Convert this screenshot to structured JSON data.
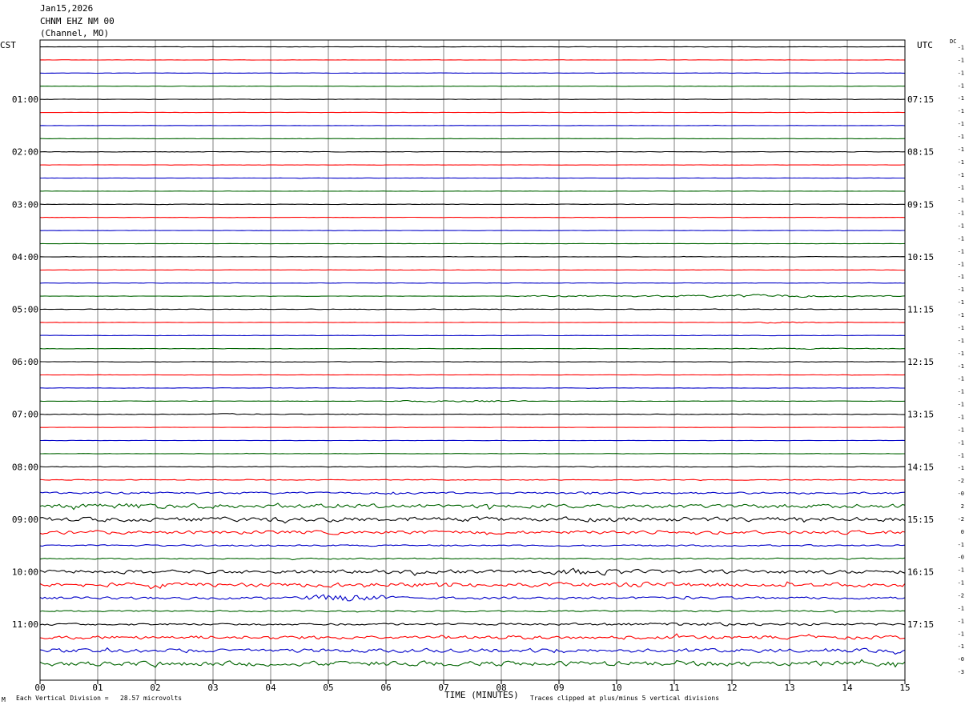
{
  "header": {
    "date": "Jan15,2026",
    "station": "CHNM EHZ NM 00",
    "network": "(Channel, MO)"
  },
  "left_timezone": "CST",
  "right_timezone": "UTC",
  "dc_label": "DC",
  "footer": {
    "scale_note": "Each Vertical Division =   28.57 microvolts",
    "clip_note": "Traces clipped at plus/minus 5 vertical divisions",
    "marker": "M"
  },
  "chart_data": {
    "type": "line",
    "title": "",
    "xlabel": "TIME (MINUTES)",
    "ylabel": "",
    "xlim": [
      0,
      15
    ],
    "x_ticks": [
      "00",
      "01",
      "02",
      "03",
      "04",
      "05",
      "06",
      "07",
      "08",
      "09",
      "10",
      "11",
      "12",
      "13",
      "14",
      "15"
    ],
    "grid": true,
    "trace_colors": [
      "#000000",
      "#ff0000",
      "#0000c8",
      "#006400"
    ],
    "traces_per_hour": 4,
    "trace_minutes": 15,
    "num_traces": 48,
    "left_hour_labels": [
      {
        "trace": 4,
        "label": "01:00"
      },
      {
        "trace": 8,
        "label": "02:00"
      },
      {
        "trace": 12,
        "label": "03:00"
      },
      {
        "trace": 16,
        "label": "04:00"
      },
      {
        "trace": 20,
        "label": "05:00"
      },
      {
        "trace": 24,
        "label": "06:00"
      },
      {
        "trace": 28,
        "label": "07:00"
      },
      {
        "trace": 32,
        "label": "08:00"
      },
      {
        "trace": 36,
        "label": "09:00"
      },
      {
        "trace": 40,
        "label": "10:00"
      },
      {
        "trace": 44,
        "label": "11:00"
      }
    ],
    "right_hour_labels": [
      {
        "trace": 4,
        "label": "07:15"
      },
      {
        "trace": 8,
        "label": "08:15"
      },
      {
        "trace": 12,
        "label": "09:15"
      },
      {
        "trace": 16,
        "label": "10:15"
      },
      {
        "trace": 20,
        "label": "11:15"
      },
      {
        "trace": 24,
        "label": "12:15"
      },
      {
        "trace": 28,
        "label": "13:15"
      },
      {
        "trace": 32,
        "label": "14:15"
      },
      {
        "trace": 36,
        "label": "15:15"
      },
      {
        "trace": 40,
        "label": "16:15"
      },
      {
        "trace": 44,
        "label": "17:15"
      }
    ],
    "dc_offsets": [
      "-1",
      "-1",
      "-1",
      "-1",
      "-1",
      "-1",
      "-1",
      "-1",
      "-1",
      "-1",
      "-1",
      "-1",
      "-1",
      "-1",
      "-1",
      "-1",
      "-1",
      "-1",
      "-1",
      "-1",
      "-1",
      "-1",
      "-1",
      "-1",
      "-1",
      "-1",
      "-1",
      "-1",
      "-1",
      "-1",
      "-1",
      "-1",
      "-1",
      "-1",
      "-2",
      "-0",
      "2",
      "-2",
      "0",
      "-1",
      "-0",
      "-1",
      "-1",
      "-2",
      "-1",
      "-1",
      "-1",
      "-1",
      "-0",
      "-3"
    ],
    "traces": [
      {
        "i": 0,
        "base": 0.3
      },
      {
        "i": 1,
        "base": 0.25
      },
      {
        "i": 2,
        "base": 0.25
      },
      {
        "i": 3,
        "base": 0.25
      },
      {
        "i": 4,
        "base": 0.3
      },
      {
        "i": 5,
        "base": 0.25
      },
      {
        "i": 6,
        "base": 0.25
      },
      {
        "i": 7,
        "base": 0.25
      },
      {
        "i": 8,
        "base": 0.3
      },
      {
        "i": 9,
        "base": 0.25
      },
      {
        "i": 10,
        "base": 0.25
      },
      {
        "i": 11,
        "base": 0.25
      },
      {
        "i": 12,
        "base": 0.3
      },
      {
        "i": 13,
        "base": 0.25
      },
      {
        "i": 14,
        "base": 0.25
      },
      {
        "i": 15,
        "base": 0.25
      },
      {
        "i": 16,
        "base": 0.3
      },
      {
        "i": 17,
        "base": 0.25
      },
      {
        "i": 18,
        "base": 0.3
      },
      {
        "i": 19,
        "base": 0.3,
        "bursts": [
          [
            8.0,
            15.0,
            1.6
          ],
          [
            11.5,
            13.5,
            3.0
          ]
        ]
      },
      {
        "i": 20,
        "base": 0.5
      },
      {
        "i": 21,
        "base": 0.25,
        "bursts": [
          [
            12.0,
            14.0,
            1.2
          ]
        ]
      },
      {
        "i": 22,
        "base": 0.3
      },
      {
        "i": 23,
        "base": 0.3,
        "bursts": [
          [
            11.8,
            15.0,
            1.0
          ]
        ]
      },
      {
        "i": 24,
        "base": 0.4
      },
      {
        "i": 25,
        "base": 0.25
      },
      {
        "i": 26,
        "base": 0.3
      },
      {
        "i": 27,
        "base": 0.3,
        "bursts": [
          [
            6.0,
            8.5,
            1.6
          ]
        ]
      },
      {
        "i": 28,
        "base": 0.5,
        "bursts": [
          [
            3.0,
            3.5,
            1.8
          ],
          [
            5.2,
            5.6,
            1.6
          ]
        ]
      },
      {
        "i": 29,
        "base": 0.25
      },
      {
        "i": 30,
        "base": 0.3
      },
      {
        "i": 31,
        "base": 0.3
      },
      {
        "i": 32,
        "base": 0.5
      },
      {
        "i": 33,
        "base": 0.6
      },
      {
        "i": 34,
        "base": 1.6,
        "bursts": [
          [
            6.0,
            6.2,
            5.0
          ],
          [
            8.5,
            10.5,
            2.5
          ]
        ]
      },
      {
        "i": 35,
        "base": 3.2,
        "bursts": [
          [
            0.0,
            4.0,
            5.0
          ]
        ]
      },
      {
        "i": 36,
        "base": 3.6,
        "bursts": [
          [
            4.0,
            4.5,
            6.0
          ]
        ]
      },
      {
        "i": 37,
        "base": 2.8,
        "bursts": [
          [
            10.5,
            11.0,
            4.0
          ]
        ]
      },
      {
        "i": 38,
        "base": 1.2
      },
      {
        "i": 39,
        "base": 1.0
      },
      {
        "i": 40,
        "base": 3.0,
        "bursts": [
          [
            8.5,
            10.5,
            6.0
          ]
        ]
      },
      {
        "i": 41,
        "base": 3.4,
        "bursts": [
          [
            6.5,
            7.5,
            5.0
          ],
          [
            9.5,
            12.0,
            5.0
          ]
        ]
      },
      {
        "i": 42,
        "base": 2.0,
        "bursts": [
          [
            4.5,
            6.2,
            7.0
          ]
        ]
      },
      {
        "i": 43,
        "base": 1.2
      },
      {
        "i": 44,
        "base": 1.6,
        "bursts": [
          [
            8.5,
            15.0,
            3.0
          ]
        ]
      },
      {
        "i": 45,
        "base": 2.8,
        "bursts": [
          [
            7.5,
            8.5,
            4.0
          ]
        ]
      },
      {
        "i": 46,
        "base": 3.0,
        "bursts": [
          [
            7.0,
            11.0,
            4.0
          ]
        ]
      },
      {
        "i": 47,
        "base": 3.8
      }
    ]
  }
}
